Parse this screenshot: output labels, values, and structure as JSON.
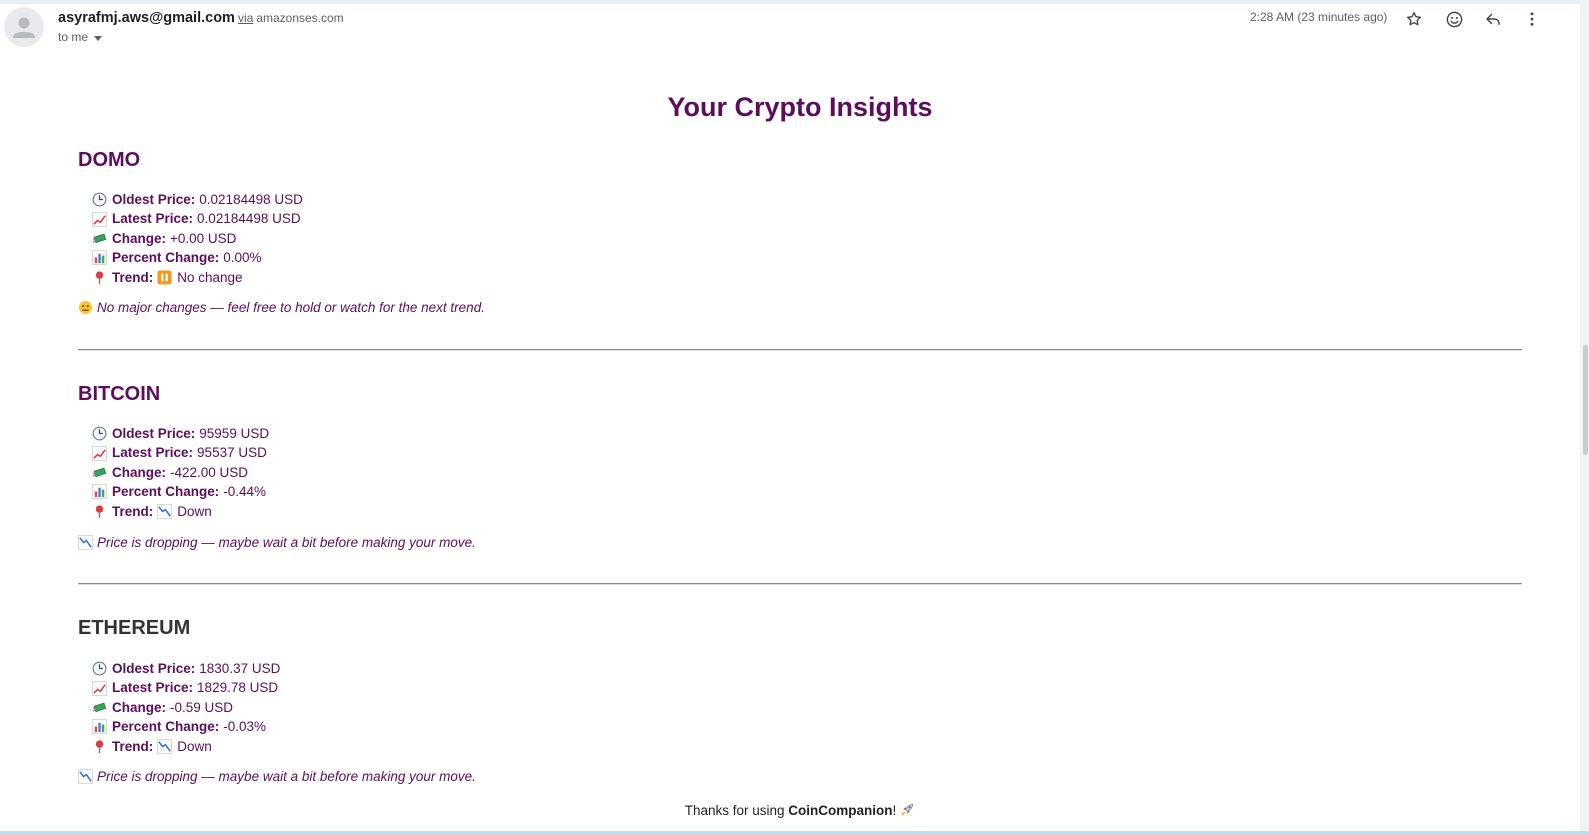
{
  "header": {
    "sender_email": "asyrafmj.aws@gmail.com",
    "via_label": "via",
    "via_domain": "amazonses.com",
    "to_label": "to me",
    "timestamp": "2:28 AM (23 minutes ago)",
    "icons": [
      "star-icon",
      "emoji-reaction-icon",
      "reply-icon",
      "more-options-icon"
    ]
  },
  "email": {
    "title": "Your Crypto Insights",
    "labels": {
      "oldest": "Oldest Price:",
      "latest": "Latest Price:",
      "change": "Change:",
      "percent": "Percent Change:",
      "trend": "Trend:"
    },
    "coins": [
      {
        "name": "DOMO",
        "oldest": "0.02184498 USD",
        "latest": "0.02184498 USD",
        "change": "+0.00 USD",
        "percent": "0.00%",
        "trend": "No change",
        "trend_icon": "pause-icon",
        "note": "No major changes — feel free to hold or watch for the next trend.",
        "note_icon": "neutral-face-icon"
      },
      {
        "name": "BITCOIN",
        "oldest": "95959 USD",
        "latest": "95537 USD",
        "change": "-422.00 USD",
        "percent": "-0.44%",
        "trend": "Down",
        "trend_icon": "chart-decreasing-icon",
        "note": "Price is dropping — maybe wait a bit before making your move.",
        "note_icon": "chart-decreasing-icon"
      },
      {
        "name": "ETHEREUM",
        "oldest": "1830.37 USD",
        "latest": "1829.78 USD",
        "change": "-0.59 USD",
        "percent": "-0.03%",
        "trend": "Down",
        "trend_icon": "chart-decreasing-icon",
        "note": "Price is dropping — maybe wait a bit before making your move.",
        "note_icon": "chart-decreasing-icon"
      }
    ],
    "footer": {
      "prefix": "Thanks for using ",
      "brand": "CoinCompanion",
      "suffix": "!"
    }
  },
  "colors": {
    "heading": "#5b0f5b",
    "heading_dark": "#333333",
    "text_muted": "#5e5e5e"
  }
}
